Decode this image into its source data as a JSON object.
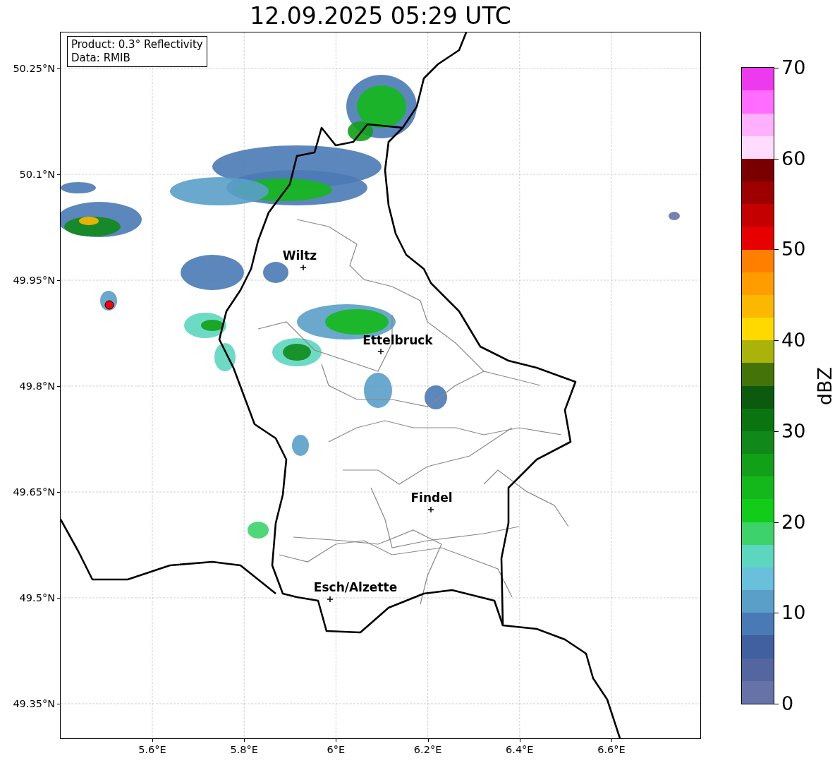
{
  "title": "12.09.2025 05:29 UTC",
  "info": [
    "Product: 0.3° Reflectivity",
    "Data: RMIB"
  ],
  "lat_ticks": [
    "50.25°N",
    "50.1°N",
    "49.95°N",
    "49.8°N",
    "49.65°N",
    "49.5°N",
    "49.35°N"
  ],
  "lon_ticks": [
    "5.6°E",
    "5.8°E",
    "6°E",
    "6.2°E",
    "6.4°E",
    "6.6°E"
  ],
  "cities": [
    {
      "label": "Wiltz"
    },
    {
      "label": "Ettelbruck"
    },
    {
      "label": "Findel"
    },
    {
      "label": "Esch/Alzette"
    }
  ],
  "colorbar": {
    "label": "dBZ",
    "ticks": [
      "70",
      "60",
      "50",
      "40",
      "30",
      "20",
      "10",
      "0"
    ],
    "segments": [
      {
        "color": "#6673a8"
      },
      {
        "color": "#53669f"
      },
      {
        "color": "#4060a0"
      },
      {
        "color": "#4a7ab5"
      },
      {
        "color": "#5a9fc8"
      },
      {
        "color": "#68c0dc"
      },
      {
        "color": "#5dd6c0"
      },
      {
        "color": "#3dd36a"
      },
      {
        "color": "#12cc1a"
      },
      {
        "color": "#14b81a"
      },
      {
        "color": "#11a017"
      },
      {
        "color": "#10891a"
      },
      {
        "color": "#0a7510"
      },
      {
        "color": "#0b5a0e"
      },
      {
        "color": "#447409"
      },
      {
        "color": "#aab30a"
      },
      {
        "color": "#ffd900"
      },
      {
        "color": "#fbb800"
      },
      {
        "color": "#ff9c00"
      },
      {
        "color": "#ff8000"
      },
      {
        "color": "#e60000"
      },
      {
        "color": "#c50000"
      },
      {
        "color": "#9c0000"
      },
      {
        "color": "#7a0000"
      },
      {
        "color": "#ffdcff"
      },
      {
        "color": "#ffb1ff"
      },
      {
        "color": "#ff6cff"
      },
      {
        "color": "#ee3aee"
      }
    ]
  }
}
